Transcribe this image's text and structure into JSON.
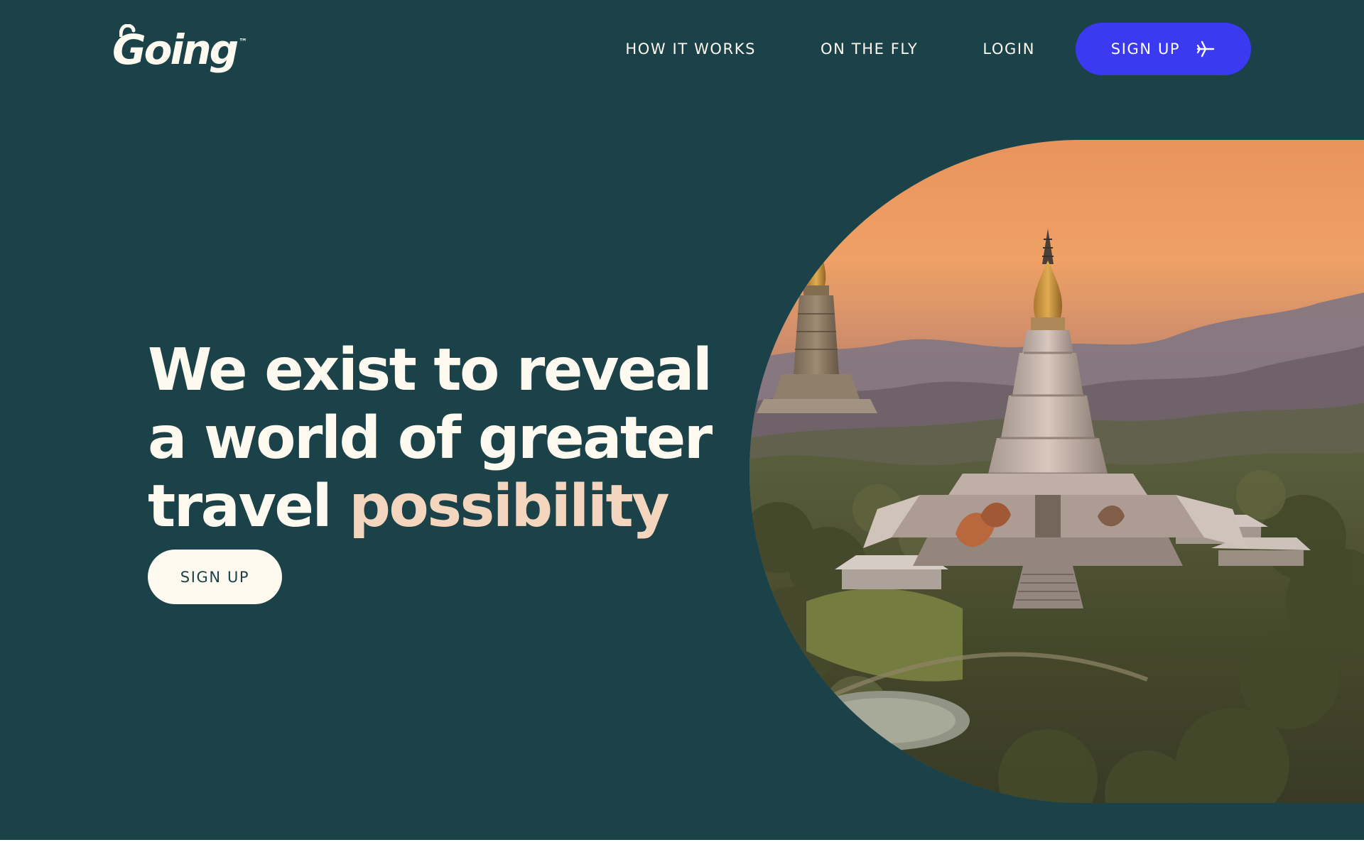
{
  "brand": {
    "name": "Going",
    "trademark": "™"
  },
  "nav": {
    "items": [
      {
        "label": "HOW IT WORKS"
      },
      {
        "label": "ON THE FLY"
      },
      {
        "label": "LOGIN"
      }
    ],
    "signup_label": "SIGN UP",
    "signup_icon": "airplane-icon"
  },
  "hero": {
    "headline_line1": "We exist to reveal",
    "headline_line2": "a world of greater",
    "headline_line3_prefix": "travel ",
    "headline_line3_accent": "possibility",
    "cta_label": "SIGN UP",
    "image_subject": "temple-pagodas-at-sunset-photo"
  },
  "colors": {
    "background": "#1b4249",
    "text_light": "#fffaf0",
    "accent_text": "#f4d6bf",
    "primary_button": "#3b3af0",
    "secondary_button": "#fffaf0"
  }
}
